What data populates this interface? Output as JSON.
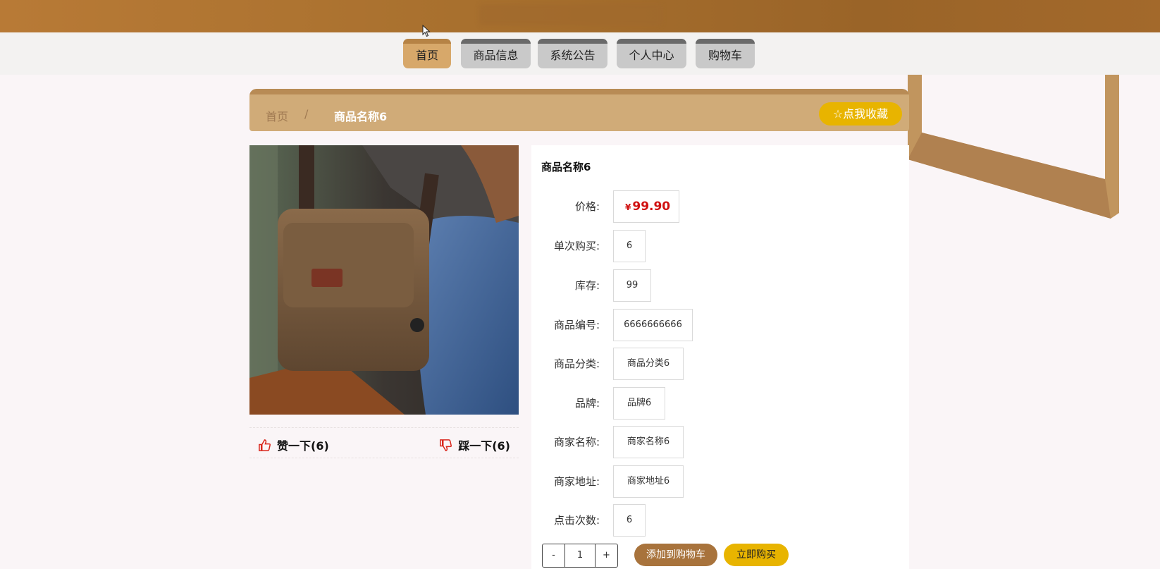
{
  "nav": {
    "items": [
      {
        "label": "首页",
        "active": true
      },
      {
        "label": "商品信息"
      },
      {
        "label": "系统公告"
      },
      {
        "label": "个人中心"
      },
      {
        "label": "购物车"
      }
    ]
  },
  "breadcrumb": {
    "home": "首页",
    "separator": "/",
    "current": "商品名称6"
  },
  "favorite_button": "☆点我收藏",
  "votes": {
    "up_label": "赞一下(6)",
    "down_label": "踩一下(6)"
  },
  "product": {
    "title": "商品名称6",
    "currency": "¥",
    "price": "99.90",
    "fields": [
      {
        "label": "价格:",
        "value": "99.90"
      },
      {
        "label": "单次购买:",
        "value": "6"
      },
      {
        "label": "库存:",
        "value": "99"
      },
      {
        "label": "商品编号:",
        "value": "6666666666"
      },
      {
        "label": "商品分类:",
        "value": "商品分类6"
      },
      {
        "label": "品牌:",
        "value": "品牌6"
      },
      {
        "label": "商家名称:",
        "value": "商家名称6"
      },
      {
        "label": "商家地址:",
        "value": "商家地址6"
      },
      {
        "label": "点击次数:",
        "value": "6"
      }
    ]
  },
  "purchase": {
    "minus": "-",
    "quantity": "1",
    "plus": "+",
    "add_to_cart": "添加到购物车",
    "buy_now": "立即购买"
  },
  "colors": {
    "header": "#a8702e",
    "accent_gold": "#e8b400",
    "breadcrumb_bg": "#d0ab78",
    "price_red": "#d01010"
  }
}
